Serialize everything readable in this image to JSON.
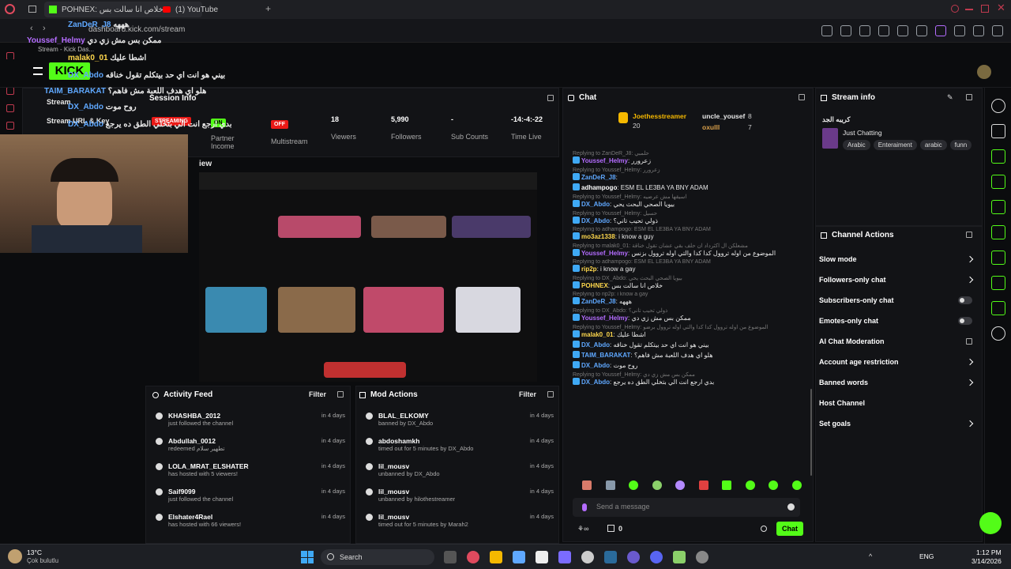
{
  "browser": {
    "tab1_title": "POHNEX: خلاص انا سالت بس",
    "tab2_title": "(1) YouTube",
    "address": "dashboard.kick.com/stream",
    "ai_label": "AI"
  },
  "kick": {
    "session_info_label": "Session Info",
    "stream_label": "Stream",
    "stream_url_label": "Stream URL & Key",
    "streaming_badge": "STREAMING",
    "stats": [
      {
        "value": "ON",
        "label": "Partner Income"
      },
      {
        "value": "OFF",
        "label": "Multistream"
      },
      {
        "value": "18",
        "label": "Viewers"
      },
      {
        "value": "5,990",
        "label": "Followers"
      },
      {
        "value": "-",
        "label": "Sub Counts"
      },
      {
        "value": "-14:-4:-22",
        "label": "Time Live"
      }
    ],
    "preview_label": "iew"
  },
  "overlay_chat": [
    {
      "user": "ZanDeR_J8",
      "text": "هههه",
      "color": "#5fa8ff"
    },
    {
      "user": "Youssef_Helmy",
      "text": "ممكن بس مش زي دي",
      "color": "#b46cff"
    },
    {
      "user": "malak0_01",
      "text": "اشطا عليك",
      "color": "#ffd84d"
    },
    {
      "user": "DX_Abdo",
      "text": "بيني هو انت اي حد بيتكلم تقول خناقه",
      "color": "#5fa8ff"
    },
    {
      "user": "TAIM_BARAKAT",
      "text": "هلو اي هدف اللعبة مش فاهم؟",
      "color": "#5fa8ff"
    },
    {
      "user": "DX_Abdo",
      "text": "روح موت",
      "color": "#5fa8ff"
    },
    {
      "user": "DX_Abdo",
      "text": "بدي ارجع انت الي بتخلي الطق ده يرجع",
      "color": "#5fa8ff"
    }
  ],
  "overlay_sub_label": "Stream - Kick Das...",
  "chat": {
    "title": "Chat",
    "leaders": [
      {
        "name": "Joethesstreamer",
        "count": "20"
      },
      {
        "name": "uncle_yousef",
        "count": "8"
      },
      {
        "name": "oxulll",
        "count": "7"
      }
    ],
    "messages": [
      {
        "reply": "Replying to ZanDeR_J8: حلمبي",
        "user": "Youssef_Helmy",
        "color": "#b46cff",
        "text": "زعرورر"
      },
      {
        "reply": "Replying to Youssef_Helmy: زعرورر",
        "user": "ZanDeR_J8",
        "color": "#5fa8ff",
        "text": ""
      },
      {
        "reply": "",
        "user": "adhampogo",
        "color": "#ffffff",
        "text": "ESM EL LE3BA YA BNY ADAM"
      },
      {
        "reply": "Replying to Youssef_Helmy: اسيقها مش عرضيه",
        "user": "DX_Abdo",
        "color": "#5fa8ff",
        "text": "بيويا الصحي البحث يحي"
      },
      {
        "reply": "Replying to Youssef_Helmy: حسيل",
        "user": "DX_Abdo",
        "color": "#5fa8ff",
        "text": "ذولي تحيب تاني؟"
      },
      {
        "reply": "Replying to adhampogo: ESM EL LE3BA YA BNY ADAM",
        "user": "mo3az1338",
        "color": "#ffd84d",
        "text": "i know a guy"
      },
      {
        "reply": "Replying to malak0_01: مشعلكن ال اكثرداد ان حلف بقي عشان تقول خناقة",
        "user": "Youssef_Helmy",
        "color": "#b46cff",
        "text": "الموضوع من اوله تروول كدا كدا والتي اوله تروول بزنس"
      },
      {
        "reply": "Replying to adhampogo: ESM EL LE3BA YA BNY ADAM",
        "user": "rip2p",
        "color": "#ffd84d",
        "text": "i know a gay"
      },
      {
        "reply": "Replying to DX_Abdo: بيويا الصحي البحث يحي",
        "user": "POHNEX",
        "color": "#ffd84d",
        "text": "خلاص انا سالت بس"
      },
      {
        "reply": "Replying to rip2p: i know a gay",
        "user": "ZanDeR_J8",
        "color": "#5fa8ff",
        "text": "هههه"
      },
      {
        "reply": "Replying to DX_Abdo: ذولي تحيب تاني؟",
        "user": "Youssef_Helmy",
        "color": "#b46cff",
        "text": "ممكن بس مش زي دي"
      },
      {
        "reply": "Replying to Youssef_Helmy: الموضوع من اوله تروول كدا كدا والتي اوله تروول برضو",
        "user": "malak0_01",
        "color": "#ffd84d",
        "text": "اشطا عليك"
      },
      {
        "reply": "",
        "user": "DX_Abdo",
        "color": "#5fa8ff",
        "text": "بيني هو انت اي حد بيتكلم تقول خناقه"
      },
      {
        "reply": "",
        "user": "TAIM_BARAKAT",
        "color": "#5fa8ff",
        "text": "هلو اي هدف اللعبة مش فاهم؟"
      },
      {
        "reply": "",
        "user": "DX_Abdo",
        "color": "#5fa8ff",
        "text": "روح موت"
      },
      {
        "reply": "Replying to Youssef_Helmy: ممكن بس مش زي دي",
        "user": "DX_Abdo",
        "color": "#5fa8ff",
        "text": "بدي ارجع انت الي بتخلي الطق ده يرجع"
      }
    ],
    "input_placeholder": "Send a message",
    "points": "0",
    "send_label": "Chat"
  },
  "stream_info": {
    "title": "Stream info",
    "stream_title": "كريبه الجد",
    "category": "Just Chatting",
    "tags": [
      "Arabic",
      "Enteraiment",
      "arabic",
      "funn"
    ]
  },
  "channel_actions": {
    "title": "Channel Actions",
    "items": [
      {
        "label": "Slow mode",
        "kind": "chevron"
      },
      {
        "label": "Followers-only chat",
        "kind": "chevron"
      },
      {
        "label": "Subscribers-only chat",
        "kind": "toggle"
      },
      {
        "label": "Emotes-only chat",
        "kind": "toggle"
      },
      {
        "label": "AI Chat Moderation",
        "kind": "external"
      },
      {
        "label": "Account age restriction",
        "kind": "chevron"
      },
      {
        "label": "Banned words",
        "kind": "chevron"
      },
      {
        "label": "Host Channel",
        "kind": "none"
      },
      {
        "label": "Set goals",
        "kind": "chevron"
      }
    ]
  },
  "activity_feed": {
    "title": "Activity Feed",
    "filter": "Filter",
    "items": [
      {
        "name": "KHASHBA_2012",
        "sub": "just followed the channel",
        "time": "in 4 days"
      },
      {
        "name": "Abdullah_0012",
        "sub": "redeemed تطهير سلام",
        "time": "in 4 days"
      },
      {
        "name": "LOLA_MRAT_ELSHATER",
        "sub": "has hosted with 5 viewers!",
        "time": "in 4 days"
      },
      {
        "name": "Saif9099",
        "sub": "just followed the channel",
        "time": "in 4 days"
      },
      {
        "name": "Elshater4Rael",
        "sub": "has hosted with 66 viewers!",
        "time": "in 4 days"
      }
    ]
  },
  "mod_actions": {
    "title": "Mod Actions",
    "filter": "Filter",
    "items": [
      {
        "name": "BLAL_ELKOMY",
        "sub": "banned by DX_Abdo",
        "time": "in 4 days"
      },
      {
        "name": "abdoshamkh",
        "sub": "timed out for 5 minutes by DX_Abdo",
        "time": "in 4 days"
      },
      {
        "name": "lil_mousv",
        "sub": "unbanned by DX_Abdo",
        "time": "in 4 days"
      },
      {
        "name": "lil_mousv",
        "sub": "unbanned by hilothestreamer",
        "time": "in 4 days"
      },
      {
        "name": "lil_mousv",
        "sub": "timed out for 5 minutes by Marah2",
        "time": "in 4 days"
      }
    ]
  },
  "taskbar": {
    "weather_temp": "13°C",
    "weather_desc": "Çok bulutlu",
    "search": "Search",
    "lang": "ENG",
    "time": "1:12 PM",
    "date": "3/14/2026"
  }
}
